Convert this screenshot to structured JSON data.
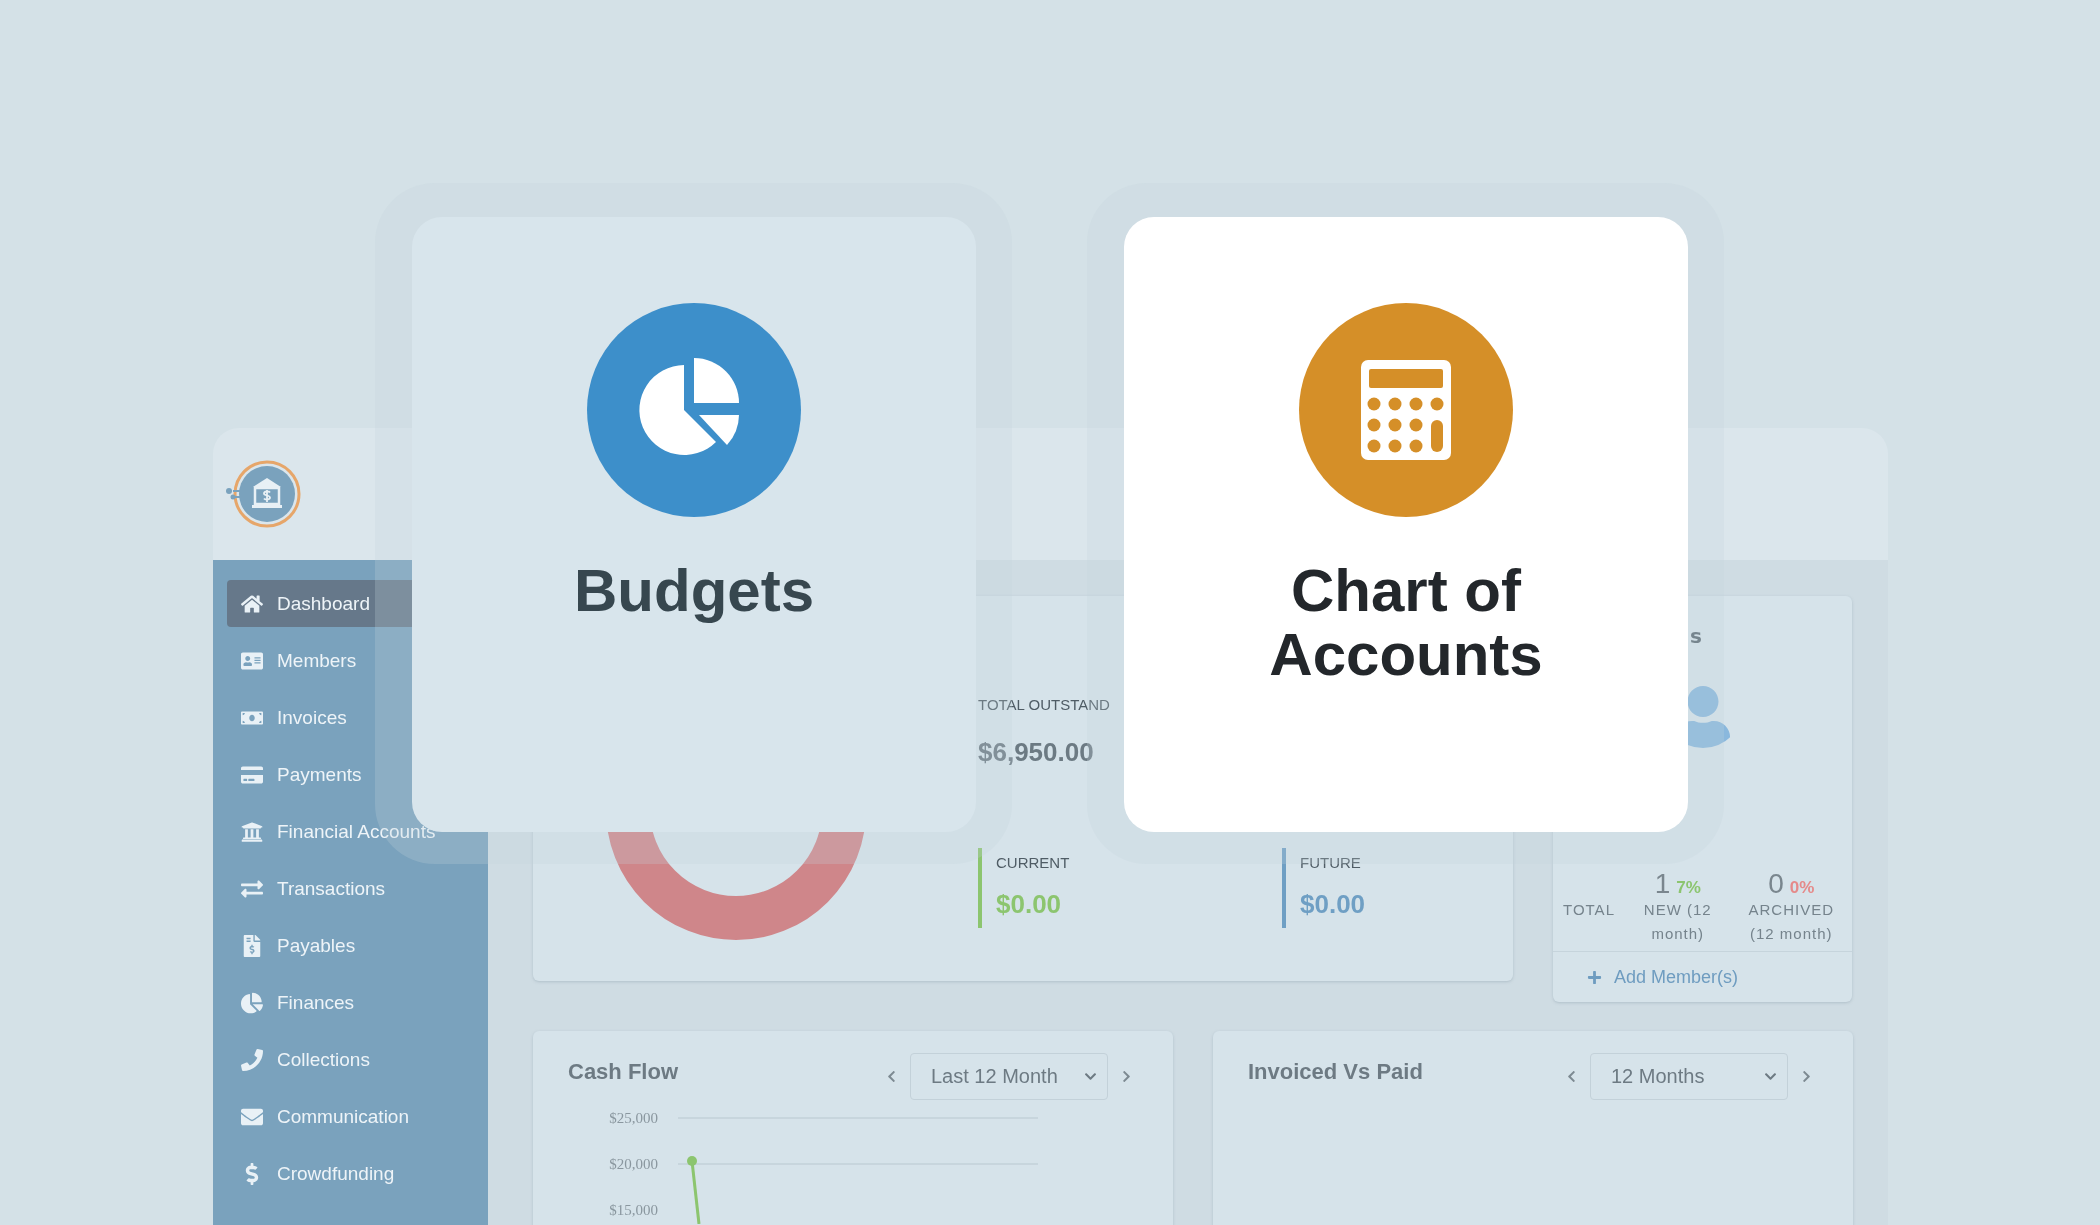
{
  "sidebar": {
    "items": [
      {
        "label": "Dashboard",
        "selected": true
      },
      {
        "label": "Members",
        "selected": false
      },
      {
        "label": "Invoices",
        "selected": false
      },
      {
        "label": "Payments",
        "selected": false
      },
      {
        "label": "Financial Accounts",
        "selected": false
      },
      {
        "label": "Transactions",
        "selected": false
      },
      {
        "label": "Payables",
        "selected": false
      },
      {
        "label": "Finances",
        "selected": false
      },
      {
        "label": "Collections",
        "selected": false
      },
      {
        "label": "Communication",
        "selected": false
      },
      {
        "label": "Crowdfunding",
        "selected": false
      }
    ]
  },
  "outstanding": {
    "total_label": "TOTAL OUTSTAND",
    "total_value": "$6,950.00",
    "parts": [
      {
        "label": "CURRENT",
        "value": "$0.00",
        "color": "#8cc56f"
      },
      {
        "label": "FUTURE",
        "value": "$0.00",
        "color": "#6f9fc4"
      }
    ]
  },
  "members": {
    "title": "s",
    "stats": [
      {
        "label": "TOTAL"
      },
      {
        "label": "NEW (12 month)",
        "value": "1",
        "change": "7%",
        "color": "#8cc56f"
      },
      {
        "label": "ARCHIVED (12 month)",
        "value": "0",
        "change": "0%",
        "color": "#e58a8a"
      }
    ],
    "add_link": "Add Member(s)"
  },
  "cash_flow": {
    "title": "Cash Flow",
    "period": "Last 12 Month",
    "y_axis_labels": [
      "$25,000",
      "$20,000",
      "$15,000"
    ]
  },
  "invoiced_vs_paid": {
    "title": "Invoiced Vs Paid",
    "period": "12 Months"
  },
  "feature_cards": [
    {
      "title": "Budgets",
      "color": "#3d8fca",
      "selected": false
    },
    {
      "title": "Chart of Accounts",
      "color": "#d58f28",
      "selected": true
    }
  ]
}
